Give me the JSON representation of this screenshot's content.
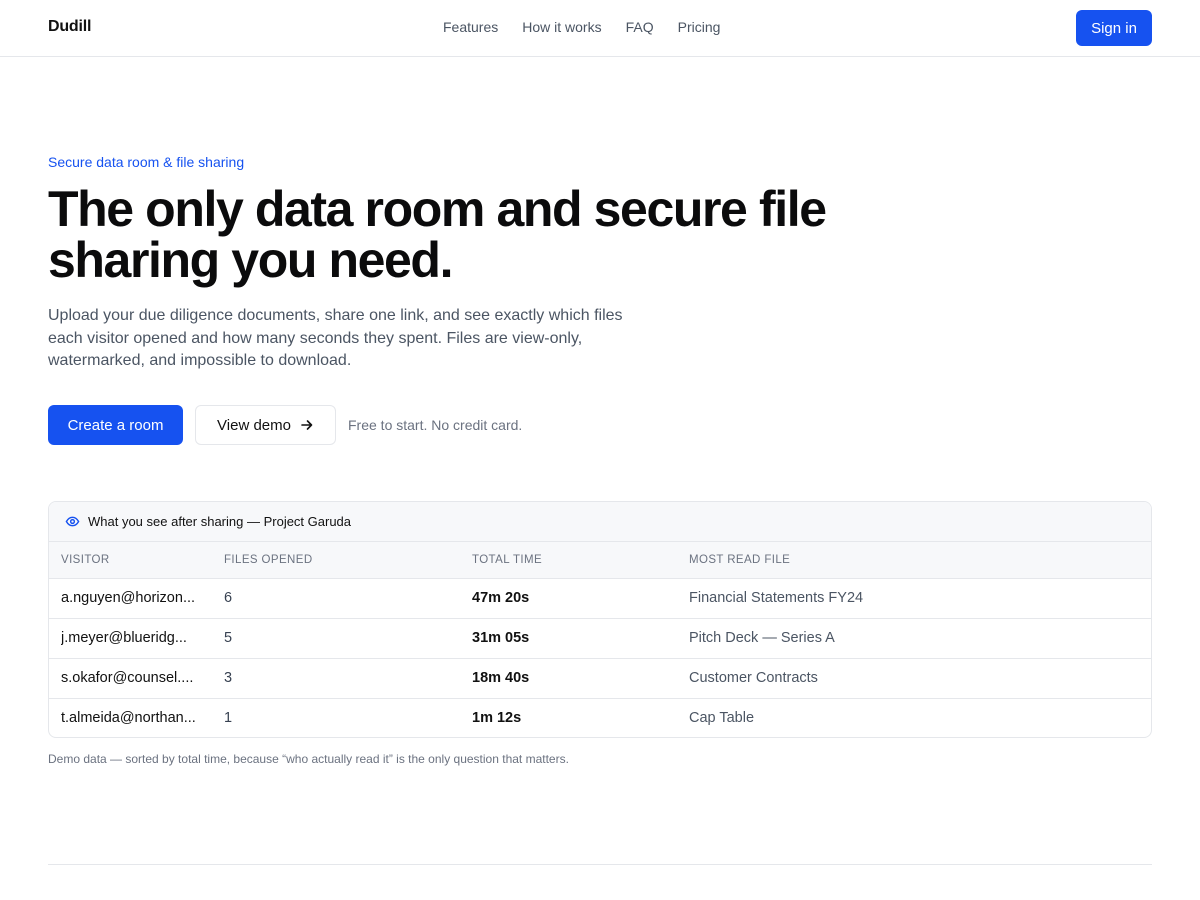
{
  "header": {
    "logo": "Dudill",
    "nav": [
      "Features",
      "How it works",
      "FAQ",
      "Pricing"
    ],
    "signin_label": "Sign in"
  },
  "hero": {
    "eyebrow": "Secure data room & file sharing",
    "headline": "The only data room and secure file sharing you need.",
    "lede": "Upload your due diligence documents, share one link, and see exactly which files each visitor opened and how many seconds they spent. Files are view-only, watermarked, and impossible to download.",
    "primary_cta": "Create a room",
    "secondary_cta": "View demo",
    "note": "Free to start. No credit card."
  },
  "demo_table": {
    "title": "What you see after sharing — Project Garuda",
    "columns": [
      "VISITOR",
      "FILES OPENED",
      "TOTAL TIME",
      "MOST READ FILE"
    ],
    "rows": [
      {
        "visitor": "a.nguyen@horizon...",
        "files": "6",
        "time": "47m 20s",
        "file": "Financial Statements FY24"
      },
      {
        "visitor": "j.meyer@blueridg...",
        "files": "5",
        "time": "31m 05s",
        "file": "Pitch Deck — Series A"
      },
      {
        "visitor": "s.okafor@counsel....",
        "files": "3",
        "time": "18m 40s",
        "file": "Customer Contracts"
      },
      {
        "visitor": "t.almeida@northan...",
        "files": "1",
        "time": "1m 12s",
        "file": "Cap Table"
      }
    ]
  },
  "footnote": "Demo data — sorted by total time, because “who actually read it” is the only question that matters.",
  "colors": {
    "accent": "#1652f0",
    "border": "#e5e7eb",
    "muted": "#6b7280"
  },
  "icons": {
    "table_header": "eye-icon",
    "secondary_cta": "arrow-right-icon"
  }
}
